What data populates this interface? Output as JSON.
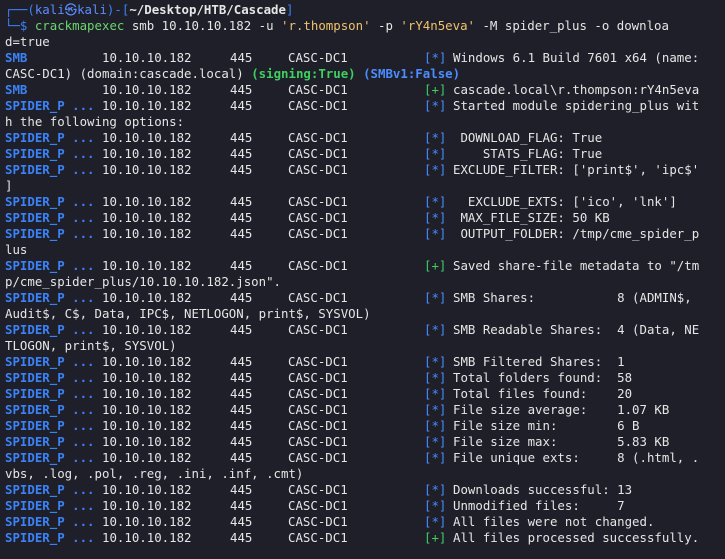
{
  "prompt": {
    "line1_prefix": "┌──(",
    "user_host": "kali㉿kali",
    "line1_mid": ")-[",
    "path": "~/Desktop/HTB/Cascade",
    "line1_suffix": "]",
    "line2_prefix": "└─$ ",
    "command_exe": "crackmapexec",
    "command_part1": " smb 10.10.10.182 -u ",
    "user_arg": "'r.thompson'",
    "command_part2": " -p ",
    "pass_arg": "'rY4n5eva'",
    "command_part3": " -M spider_plus -o downloa",
    "command_wrap": "d=true"
  },
  "rows": [
    {
      "module": "SMB",
      "ip": "10.10.10.182",
      "port": "445",
      "host": "CASC-DC1",
      "tag": "[*]",
      "tag_type": "info",
      "msg": "Windows 6.1 Build 7601 x64 (name:"
    },
    {
      "wrap_special": true,
      "text1": "CASC-DC1) (domain:cascade.local) ",
      "signing": "(signing:True)",
      "text2": " ",
      "smbv1": "(SMBv1:False)"
    },
    {
      "module": "SMB",
      "ip": "10.10.10.182",
      "port": "445",
      "host": "CASC-DC1",
      "tag": "[+]",
      "tag_type": "ok",
      "msg": "cascade.local\\r.thompson:rY4n5eva"
    },
    {
      "module": "SPIDER_P ...",
      "ip": "10.10.10.182",
      "port": "445",
      "host": "CASC-DC1",
      "tag": "[*]",
      "tag_type": "info",
      "msg": "Started module spidering_plus wit"
    },
    {
      "wrap": "h the following options:"
    },
    {
      "module": "SPIDER_P ...",
      "ip": "10.10.10.182",
      "port": "445",
      "host": "CASC-DC1",
      "tag": "[*]",
      "tag_type": "info",
      "msg": " DOWNLOAD_FLAG: True"
    },
    {
      "module": "SPIDER_P ...",
      "ip": "10.10.10.182",
      "port": "445",
      "host": "CASC-DC1",
      "tag": "[*]",
      "tag_type": "info",
      "msg": "    STATS_FLAG: True"
    },
    {
      "module": "SPIDER_P ...",
      "ip": "10.10.10.182",
      "port": "445",
      "host": "CASC-DC1",
      "tag": "[*]",
      "tag_type": "info",
      "msg": "EXCLUDE_FILTER: ['print$', 'ipc$'"
    },
    {
      "wrap": "]"
    },
    {
      "module": "SPIDER_P ...",
      "ip": "10.10.10.182",
      "port": "445",
      "host": "CASC-DC1",
      "tag": "[*]",
      "tag_type": "info",
      "msg": "  EXCLUDE_EXTS: ['ico', 'lnk']"
    },
    {
      "module": "SPIDER_P ...",
      "ip": "10.10.10.182",
      "port": "445",
      "host": "CASC-DC1",
      "tag": "[*]",
      "tag_type": "info",
      "msg": " MAX_FILE_SIZE: 50 KB"
    },
    {
      "module": "SPIDER_P ...",
      "ip": "10.10.10.182",
      "port": "445",
      "host": "CASC-DC1",
      "tag": "[*]",
      "tag_type": "info",
      "msg": " OUTPUT_FOLDER: /tmp/cme_spider_p"
    },
    {
      "wrap": "lus"
    },
    {
      "module": "SPIDER_P ...",
      "ip": "10.10.10.182",
      "port": "445",
      "host": "CASC-DC1",
      "tag": "[+]",
      "tag_type": "ok",
      "msg": "Saved share-file metadata to \"/tm"
    },
    {
      "wrap": "p/cme_spider_plus/10.10.10.182.json\"."
    },
    {
      "module": "SPIDER_P ...",
      "ip": "10.10.10.182",
      "port": "445",
      "host": "CASC-DC1",
      "tag": "[*]",
      "tag_type": "info",
      "msg": "SMB Shares:           8 (ADMIN$,"
    },
    {
      "wrap": "Audit$, C$, Data, IPC$, NETLOGON, print$, SYSVOL)"
    },
    {
      "module": "SPIDER_P ...",
      "ip": "10.10.10.182",
      "port": "445",
      "host": "CASC-DC1",
      "tag": "[*]",
      "tag_type": "info",
      "msg": "SMB Readable Shares:  4 (Data, NE"
    },
    {
      "wrap": "TLOGON, print$, SYSVOL)"
    },
    {
      "module": "SPIDER_P ...",
      "ip": "10.10.10.182",
      "port": "445",
      "host": "CASC-DC1",
      "tag": "[*]",
      "tag_type": "info",
      "msg": "SMB Filtered Shares:  1"
    },
    {
      "module": "SPIDER_P ...",
      "ip": "10.10.10.182",
      "port": "445",
      "host": "CASC-DC1",
      "tag": "[*]",
      "tag_type": "info",
      "msg": "Total folders found:  58"
    },
    {
      "module": "SPIDER_P ...",
      "ip": "10.10.10.182",
      "port": "445",
      "host": "CASC-DC1",
      "tag": "[*]",
      "tag_type": "info",
      "msg": "Total files found:    20"
    },
    {
      "module": "SPIDER_P ...",
      "ip": "10.10.10.182",
      "port": "445",
      "host": "CASC-DC1",
      "tag": "[*]",
      "tag_type": "info",
      "msg": "File size average:    1.07 KB"
    },
    {
      "module": "SPIDER_P ...",
      "ip": "10.10.10.182",
      "port": "445",
      "host": "CASC-DC1",
      "tag": "[*]",
      "tag_type": "info",
      "msg": "File size min:        6 B"
    },
    {
      "module": "SPIDER_P ...",
      "ip": "10.10.10.182",
      "port": "445",
      "host": "CASC-DC1",
      "tag": "[*]",
      "tag_type": "info",
      "msg": "File size max:        5.83 KB"
    },
    {
      "module": "SPIDER_P ...",
      "ip": "10.10.10.182",
      "port": "445",
      "host": "CASC-DC1",
      "tag": "[*]",
      "tag_type": "info",
      "msg": "File unique exts:     8 (.html, ."
    },
    {
      "wrap": "vbs, .log, .pol, .reg, .ini, .inf, .cmt)"
    },
    {
      "module": "SPIDER_P ...",
      "ip": "10.10.10.182",
      "port": "445",
      "host": "CASC-DC1",
      "tag": "[*]",
      "tag_type": "info",
      "msg": "Downloads successful: 13"
    },
    {
      "module": "SPIDER_P ...",
      "ip": "10.10.10.182",
      "port": "445",
      "host": "CASC-DC1",
      "tag": "[*]",
      "tag_type": "info",
      "msg": "Unmodified files:     7"
    },
    {
      "module": "SPIDER_P ...",
      "ip": "10.10.10.182",
      "port": "445",
      "host": "CASC-DC1",
      "tag": "[*]",
      "tag_type": "info",
      "msg": "All files were not changed."
    },
    {
      "module": "SPIDER_P ...",
      "ip": "10.10.10.182",
      "port": "445",
      "host": "CASC-DC1",
      "tag": "[+]",
      "tag_type": "ok",
      "msg": "All files processed successfully."
    }
  ],
  "colors": {
    "background": "#1e1f29",
    "module_blue": "#3b82f6",
    "tag_info": "#4b8cff",
    "tag_ok": "#3fcf60",
    "text": "#e6e6e6"
  }
}
